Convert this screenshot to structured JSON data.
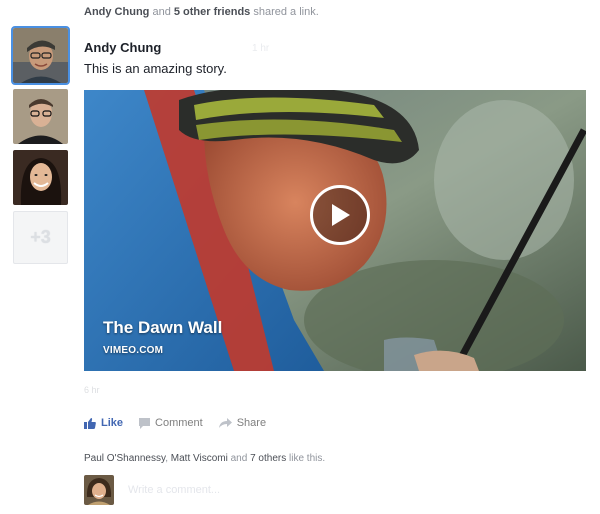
{
  "story": {
    "actor": "Andy Chung",
    "connector": "and",
    "others": "5 other friends",
    "verb": "shared a link."
  },
  "friends": {
    "more_label": "+3",
    "avatars": [
      "friend-avatar-1",
      "friend-avatar-2",
      "friend-avatar-3"
    ]
  },
  "post": {
    "author": "Andy Chung",
    "timestamp": "1 hr",
    "text": "This is an amazing story.",
    "meta": "6 hr"
  },
  "link": {
    "title": "The Dawn Wall",
    "source": "VIMEO.COM",
    "play_icon": "play-icon"
  },
  "actions": {
    "like": "Like",
    "comment": "Comment",
    "share": "Share"
  },
  "likes": {
    "name1": "Paul O'Shannessy",
    "sep": ",",
    "name2": "Matt Viscomi",
    "and": "and",
    "others": "7 others",
    "tail": "like this."
  },
  "comment_box": {
    "placeholder": "Write a comment..."
  },
  "colors": {
    "link_blue": "#4267b2",
    "selected_outline": "#4a90e2",
    "muted_text": "#90949c"
  }
}
